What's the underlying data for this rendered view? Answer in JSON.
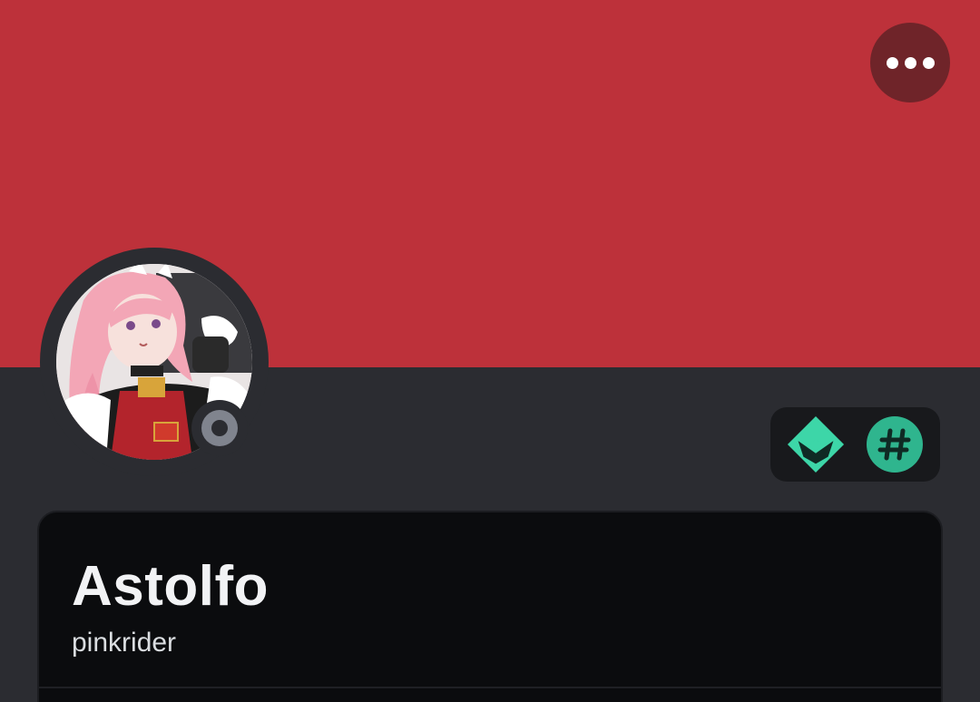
{
  "profile": {
    "display_name": "Astolfo",
    "username": "pinkrider",
    "status": "offline",
    "banner_color": "#bd313a"
  },
  "header": {
    "more_icon": "more-horizontal-icon"
  },
  "badges": [
    {
      "icon": "nitro-boost-badge-icon",
      "color": "#3dd6a8"
    },
    {
      "icon": "hashtag-badge-icon",
      "color": "#2fb58e"
    }
  ],
  "colors": {
    "background": "#2b2c31",
    "card": "#0b0c0e",
    "text_primary": "#f2f3f5",
    "status_offline": "#80848e"
  }
}
